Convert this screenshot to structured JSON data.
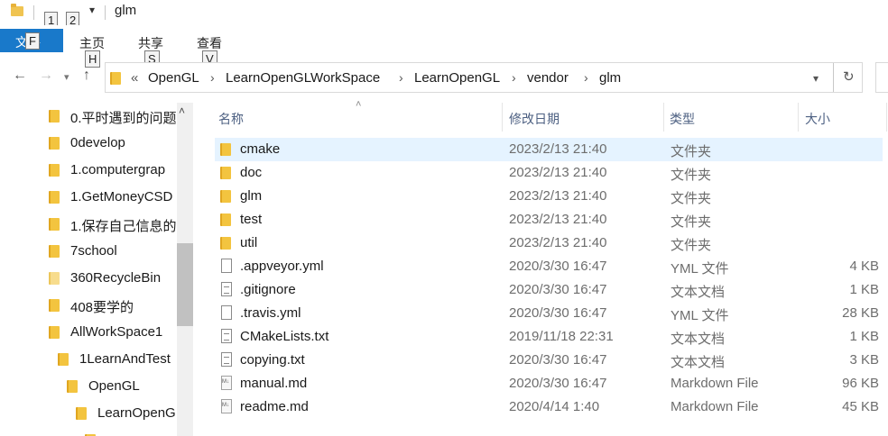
{
  "window": {
    "title": "glm",
    "quick_access_keytips": [
      "1",
      "2"
    ]
  },
  "ribbon": {
    "file_tab": "文件",
    "file_keytip": "F",
    "tabs": [
      {
        "label": "主页",
        "keytip": "H"
      },
      {
        "label": "共享",
        "keytip": "S"
      },
      {
        "label": "查看",
        "keytip": "V"
      }
    ]
  },
  "address": {
    "overflow": "«",
    "crumbs": [
      "OpenGL",
      "LearnOpenGLWorkSpace",
      "LearnOpenGL",
      "vendor",
      "glm"
    ]
  },
  "nav_pane": {
    "items": [
      "0.平时遇到的问题",
      "0develop",
      "1.computergrap",
      "1.GetMoneyCSD",
      "1.保存自己信息的",
      "7school",
      "360RecycleBin",
      "408要学的",
      "AllWorkSpace1",
      "1LearnAndTest",
      "OpenGL",
      "LearnOpenG"
    ]
  },
  "file_list": {
    "columns": {
      "name": "名称",
      "date": "修改日期",
      "type": "类型",
      "size": "大小"
    },
    "rows": [
      {
        "name": "cmake",
        "date": "2023/2/13 21:40",
        "type": "文件夹",
        "size": "",
        "icon": "folder-icon"
      },
      {
        "name": "doc",
        "date": "2023/2/13 21:40",
        "type": "文件夹",
        "size": "",
        "icon": "folder-icon"
      },
      {
        "name": "glm",
        "date": "2023/2/13 21:40",
        "type": "文件夹",
        "size": "",
        "icon": "folder-icon"
      },
      {
        "name": "test",
        "date": "2023/2/13 21:40",
        "type": "文件夹",
        "size": "",
        "icon": "folder-icon"
      },
      {
        "name": "util",
        "date": "2023/2/13 21:40",
        "type": "文件夹",
        "size": "",
        "icon": "folder-icon"
      },
      {
        "name": ".appveyor.yml",
        "date": "2020/3/30 16:47",
        "type": "YML 文件",
        "size": "4 KB",
        "icon": "file-icon"
      },
      {
        "name": ".gitignore",
        "date": "2020/3/30 16:47",
        "type": "文本文档",
        "size": "1 KB",
        "icon": "text-file-icon"
      },
      {
        "name": ".travis.yml",
        "date": "2020/3/30 16:47",
        "type": "YML 文件",
        "size": "28 KB",
        "icon": "file-icon"
      },
      {
        "name": "CMakeLists.txt",
        "date": "2019/11/18 22:31",
        "type": "文本文档",
        "size": "1 KB",
        "icon": "text-file-icon"
      },
      {
        "name": "copying.txt",
        "date": "2020/3/30 16:47",
        "type": "文本文档",
        "size": "3 KB",
        "icon": "text-file-icon"
      },
      {
        "name": "manual.md",
        "date": "2020/3/30 16:47",
        "type": "Markdown File",
        "size": "96 KB",
        "icon": "markdown-file-icon"
      },
      {
        "name": "readme.md",
        "date": "2020/4/14 1:40",
        "type": "Markdown File",
        "size": "45 KB",
        "icon": "markdown-file-icon"
      }
    ]
  }
}
